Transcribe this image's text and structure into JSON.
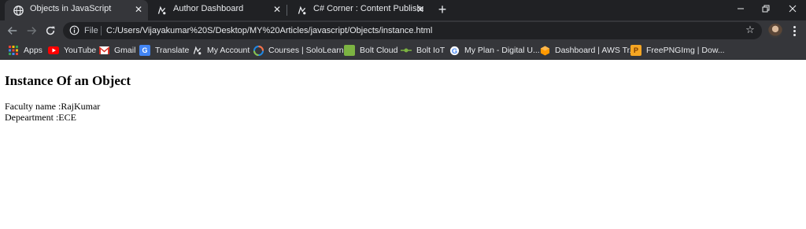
{
  "browser": {
    "tabs": [
      {
        "title": "Objects in JavaScript",
        "icon": "globe-icon",
        "active": true
      },
      {
        "title": "Author Dashboard",
        "icon": "c-sharp-corner-icon",
        "active": false
      },
      {
        "title": "C# Corner : Content Publisher",
        "icon": "c-sharp-corner-icon",
        "active": false
      }
    ],
    "new_tab_icon": "plus-icon",
    "window_controls": [
      "minimize-icon",
      "restore-icon",
      "close-icon"
    ]
  },
  "toolbar": {
    "scheme_label": "File",
    "url": "C:/Users/Vijayakumar%20S/Desktop/MY%20Articles/javascript/Objects/instance.html"
  },
  "bookmarks": [
    {
      "label": "Apps",
      "icon": "apps-grid-icon",
      "color": "#e8eaed"
    },
    {
      "label": "YouTube",
      "icon": "youtube-icon",
      "color": "#ff0000"
    },
    {
      "label": "Gmail",
      "icon": "gmail-icon",
      "color": "#d93025"
    },
    {
      "label": "Translate",
      "icon": "google-translate-icon",
      "color": "#4285f4"
    },
    {
      "label": "My Account",
      "icon": "c-sharp-corner-icon",
      "color": "#8ab4f8"
    },
    {
      "label": "Courses | SoloLearn...",
      "icon": "sololearn-icon",
      "color": "#1e88e5"
    },
    {
      "label": "Bolt Cloud",
      "icon": "bolt-cloud-icon",
      "color": "#7cb342"
    },
    {
      "label": "Bolt IoT",
      "icon": "bolt-iot-icon",
      "color": "#7cb342"
    },
    {
      "label": "My Plan - Digital U...",
      "icon": "google-icon",
      "color": "#ffffff"
    },
    {
      "label": "Dashboard | AWS Tr...",
      "icon": "aws-icon",
      "color": "#ff9900"
    },
    {
      "label": "FreePNGImg | Dow...",
      "icon": "freepngimg-icon",
      "color": "#f5a623"
    }
  ],
  "page": {
    "heading": "Instance Of an Object",
    "lines": [
      "Faculty name :RajKumar",
      "Depeartment :ECE"
    ]
  }
}
